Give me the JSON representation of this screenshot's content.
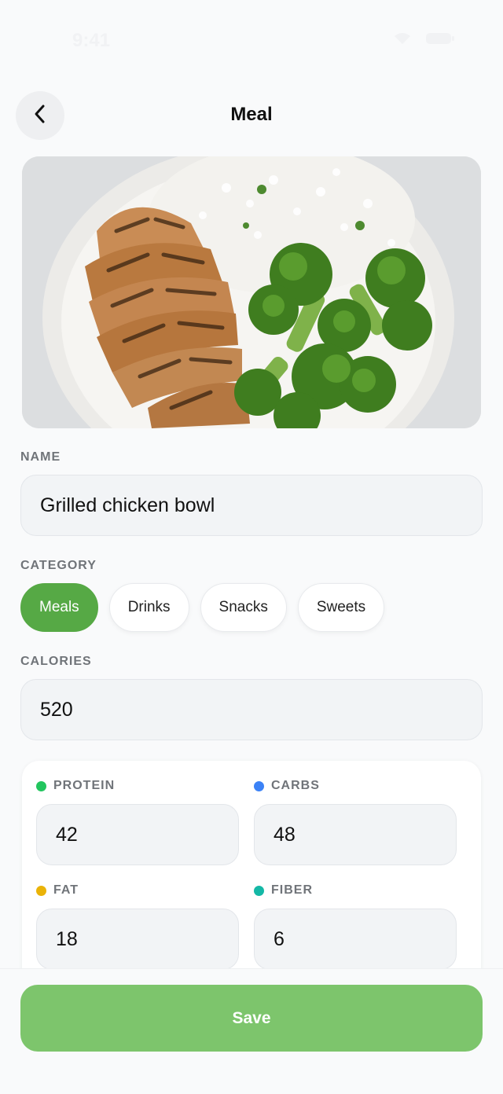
{
  "status_bar": {
    "time": "9:41"
  },
  "header": {
    "title": "Meal"
  },
  "name_field": {
    "label": "NAME",
    "value": "Grilled chicken bowl"
  },
  "category": {
    "label": "CATEGORY",
    "options": [
      "Meals",
      "Drinks",
      "Snacks",
      "Sweets"
    ],
    "selected": "Meals"
  },
  "calories_field": {
    "label": "CALORIES",
    "value": "520"
  },
  "macros": {
    "protein": {
      "label": "PROTEIN",
      "value": "42",
      "color": "#22c55e"
    },
    "carbs": {
      "label": "CARBS",
      "value": "48",
      "color": "#3b82f6"
    },
    "fat": {
      "label": "FAT",
      "value": "18",
      "color": "#eab308"
    },
    "fiber": {
      "label": "FIBER",
      "value": "6",
      "color": "#14b8a6"
    }
  },
  "actions": {
    "save_label": "Save"
  },
  "colors": {
    "accent": "#56a945",
    "save_button": "#7dc56c",
    "field_bg": "#f2f4f6"
  }
}
